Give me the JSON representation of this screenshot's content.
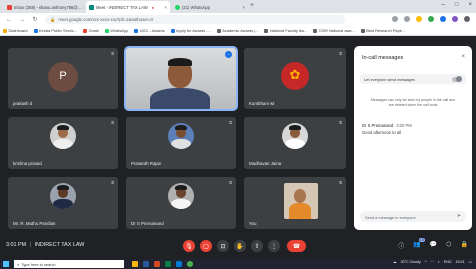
{
  "browser": {
    "tabs": [
      {
        "label": "Inbox (358) - shanu.anthony786@...",
        "favicon_color": "#ea4335",
        "active": false
      },
      {
        "label": "Meet - INDIRECT TAX LAW",
        "favicon_color": "#00897b",
        "active": true
      },
      {
        "label": "(21) WhatsApp",
        "favicon_color": "#25d366",
        "active": false
      }
    ],
    "new_tab_label": "+",
    "address": "meet.google.com/xxx-xxxx-xxx?pli=1&authuser=0",
    "bookmarks": [
      {
        "label": "Dashboard",
        "color": "#f9ab00"
      },
      {
        "label": "Kerala Public Servic...",
        "color": "#1a73e8"
      },
      {
        "label": "Gmail",
        "color": "#ea4335"
      },
      {
        "label": "WhatsApp",
        "color": "#25d366"
      },
      {
        "label": "UGC - Awards",
        "color": "#1a73e8"
      },
      {
        "label": "Apply for Awards -...",
        "color": "#1a73e8"
      },
      {
        "label": "Academic Awards |...",
        "color": "#5f6368"
      },
      {
        "label": "National Faculty Aw...",
        "color": "#5f6368"
      },
      {
        "label": "CSIR National awa...",
        "color": "#5f6368"
      },
      {
        "label": "Best Research Pape...",
        "color": "#5f6368"
      }
    ]
  },
  "participants": [
    {
      "name": "prakash d",
      "type": "initial",
      "color": "#6d4c41"
    },
    {
      "name": "",
      "type": "photo",
      "speaking": true
    },
    {
      "name": "Kumbhani wt",
      "type": "logo",
      "color": "#c62828"
    },
    {
      "name": "krishna prasad",
      "type": "photo"
    },
    {
      "name": "Prasanth Rajan",
      "type": "photo"
    },
    {
      "name": "Madhavan Jaina",
      "type": "photo"
    },
    {
      "name": "Mr. R. Muthu Pandian",
      "type": "photo"
    },
    {
      "name": "Dr S Premanand",
      "type": "photo"
    },
    {
      "name": "You",
      "type": "photo"
    }
  ],
  "chat": {
    "title": "In-call messages",
    "toggle_label": "Let everyone send messages",
    "notice": "Messages can only be seen by people in the call and are deleted when the call ends",
    "messages": [
      {
        "sender": "Dr S Premanand",
        "time": "3:00 PM",
        "text": "Good afternoon to all"
      }
    ],
    "input_placeholder": "Send a message to everyone"
  },
  "meeting": {
    "time": "3:01 PM",
    "separator": "|",
    "title": "INDIRECT TAX LAW",
    "people_count": "10"
  },
  "taskbar": {
    "search_placeholder": "Type here to search",
    "weather": "30°C Cloudy",
    "language": "ENG",
    "clock": "15:01"
  },
  "colors": {
    "meet_bg": "#202124",
    "tile_bg": "#3c4043",
    "accent": "#8ab4f8",
    "danger": "#ea4335"
  }
}
